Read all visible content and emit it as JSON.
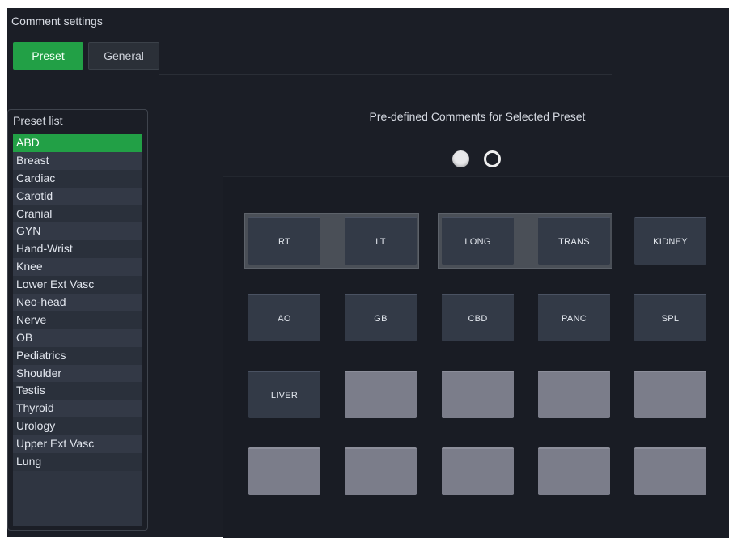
{
  "title": "Comment settings",
  "tabs": {
    "preset_label": "Preset",
    "general_label": "General",
    "active": "Preset"
  },
  "preset_list": {
    "heading": "Preset list",
    "selected": "ABD",
    "items": [
      "ABD",
      "Breast",
      "Cardiac",
      "Carotid",
      "Cranial",
      "GYN",
      "Hand-Wrist",
      "Knee",
      "Lower Ext Vasc",
      "Neo-head",
      "Nerve",
      "OB",
      "Pediatrics",
      "Shoulder",
      "Testis",
      "Thyroid",
      "Urology",
      "Upper Ext Vasc",
      "Lung"
    ]
  },
  "comments": {
    "heading": "Pre-defined Comments for Selected Preset",
    "pages": {
      "current": 1,
      "total": 2
    },
    "rows": [
      [
        "RT",
        "LT",
        "LONG",
        "TRANS",
        "KIDNEY"
      ],
      [
        "AO",
        "GB",
        "CBD",
        "PANC",
        "SPL"
      ],
      [
        "LIVER",
        "",
        "",
        "",
        ""
      ],
      [
        "",
        "",
        "",
        "",
        ""
      ]
    ]
  },
  "colors": {
    "accent_green": "#22a046",
    "background": "#1b1e26",
    "filled_button": "#333a47",
    "empty_button": "#7b7d8a"
  }
}
